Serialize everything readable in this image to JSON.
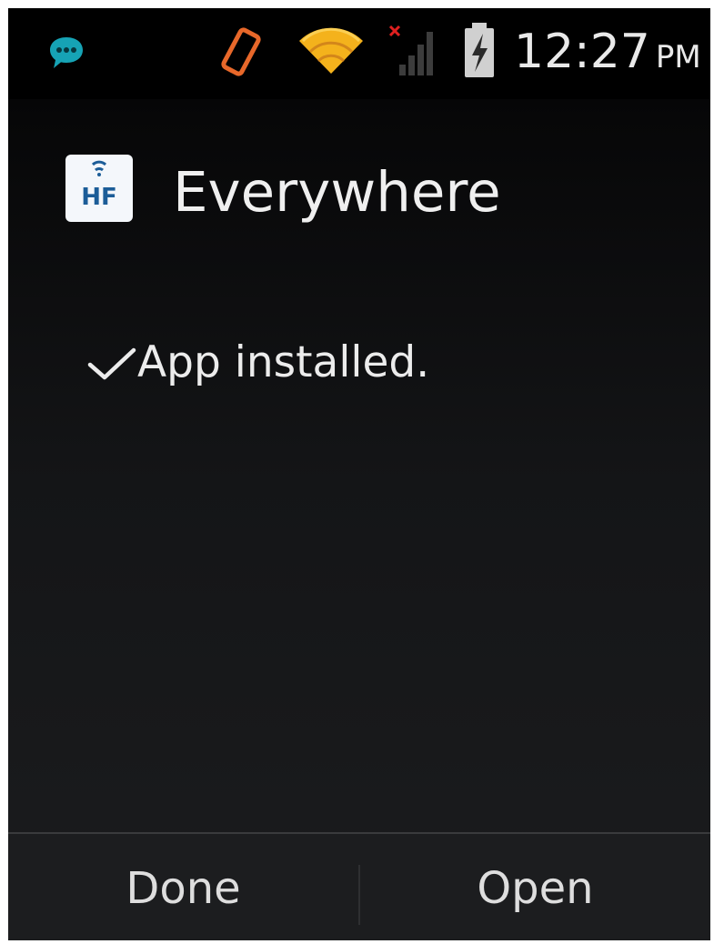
{
  "status_bar": {
    "time": "12:27",
    "ampm": "PM",
    "icons": [
      "chat-bubble-icon",
      "screen-rotate-icon",
      "wifi-icon",
      "signal-off-icon",
      "battery-charging-icon"
    ]
  },
  "app": {
    "icon_text": "HF",
    "name": "Everywhere"
  },
  "install": {
    "status": "App installed."
  },
  "buttons": {
    "done_label": "Done",
    "open_label": "Open"
  },
  "colors": {
    "chat_icon": "#16a3b5",
    "rotate_icon": "#e8682a",
    "wifi_icon": "#f2a51a",
    "signal_off_x": "#e02020",
    "app_icon_blue": "#1c5d98",
    "text": "#efefef"
  }
}
